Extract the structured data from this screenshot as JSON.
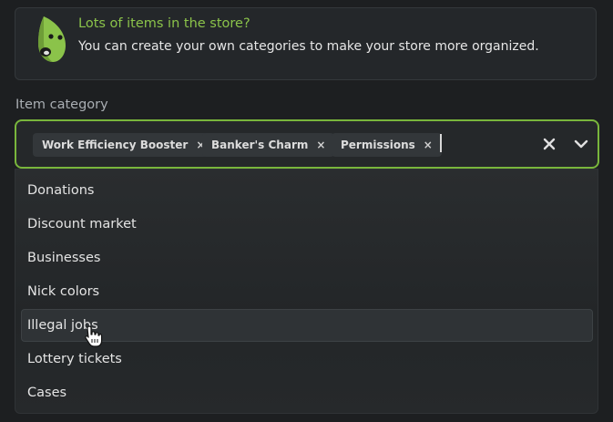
{
  "banner": {
    "title": "Lots of items in the store?",
    "text": "You can create your own categories to make your store more organized.",
    "icon": "leaf-mascot-icon",
    "accent_color": "#8bc34a"
  },
  "field": {
    "label": "Item category",
    "border_color": "#79b63c",
    "selected_chips": [
      {
        "label": "Work Efficiency Booster",
        "remove_glyph": "×"
      },
      {
        "label": "Banker's Charm",
        "remove_glyph": "×"
      },
      {
        "label": "Permissions",
        "remove_glyph": "×"
      }
    ],
    "clear_icon": "close-icon",
    "toggle_icon": "chevron-down-icon"
  },
  "menu": {
    "options": [
      {
        "label": "Donations"
      },
      {
        "label": "Discount market"
      },
      {
        "label": "Businesses"
      },
      {
        "label": "Nick colors"
      },
      {
        "label": "Illegal jobs",
        "hovered": true
      },
      {
        "label": "Lottery tickets"
      },
      {
        "label": "Cases"
      }
    ]
  },
  "cursor": "hand-pointer-icon"
}
